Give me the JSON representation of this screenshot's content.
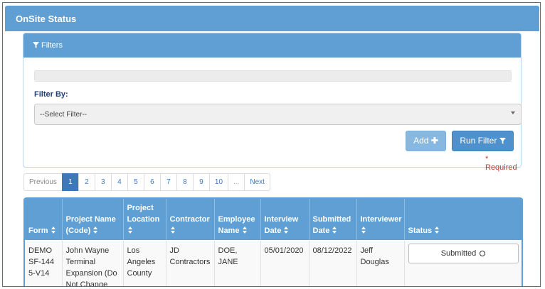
{
  "app": {
    "title": "OnSite Status"
  },
  "filters": {
    "title": "Filters",
    "filter_by_label": "Filter By:",
    "select_value": "--Select Filter--",
    "add_label": "Add",
    "add_icon": "plus-icon",
    "run_label": "Run Filter",
    "run_icon": "filter-icon",
    "required_text": "* Required"
  },
  "pagination": {
    "previous": "Previous",
    "pages": [
      "1",
      "2",
      "3",
      "4",
      "5",
      "6",
      "7",
      "8",
      "9",
      "10"
    ],
    "active_page": "1",
    "ellipsis": "...",
    "next": "Next"
  },
  "table": {
    "columns": [
      "Form",
      "Project Name (Code)",
      "Project Location",
      "Contractor",
      "Employee Name",
      "Interview Date",
      "Submitted Date",
      "Interviewer",
      "Status"
    ],
    "rows": [
      {
        "form": "DEMO SF-1445-V14",
        "project_name": "John Wayne Terminal Expansion (Do Not Change",
        "project_location": "Los Angeles County",
        "contractor": "JD Contractors",
        "employee_name": "DOE, JANE",
        "interview_date": "05/01/2020",
        "submitted_date": "08/12/2022",
        "interviewer": "Jeff Douglas",
        "status": "Submitted"
      }
    ]
  },
  "colors": {
    "header_blue": "#5f9fd3",
    "active_page": "#3f77b8",
    "required_red": "#c0392b"
  }
}
